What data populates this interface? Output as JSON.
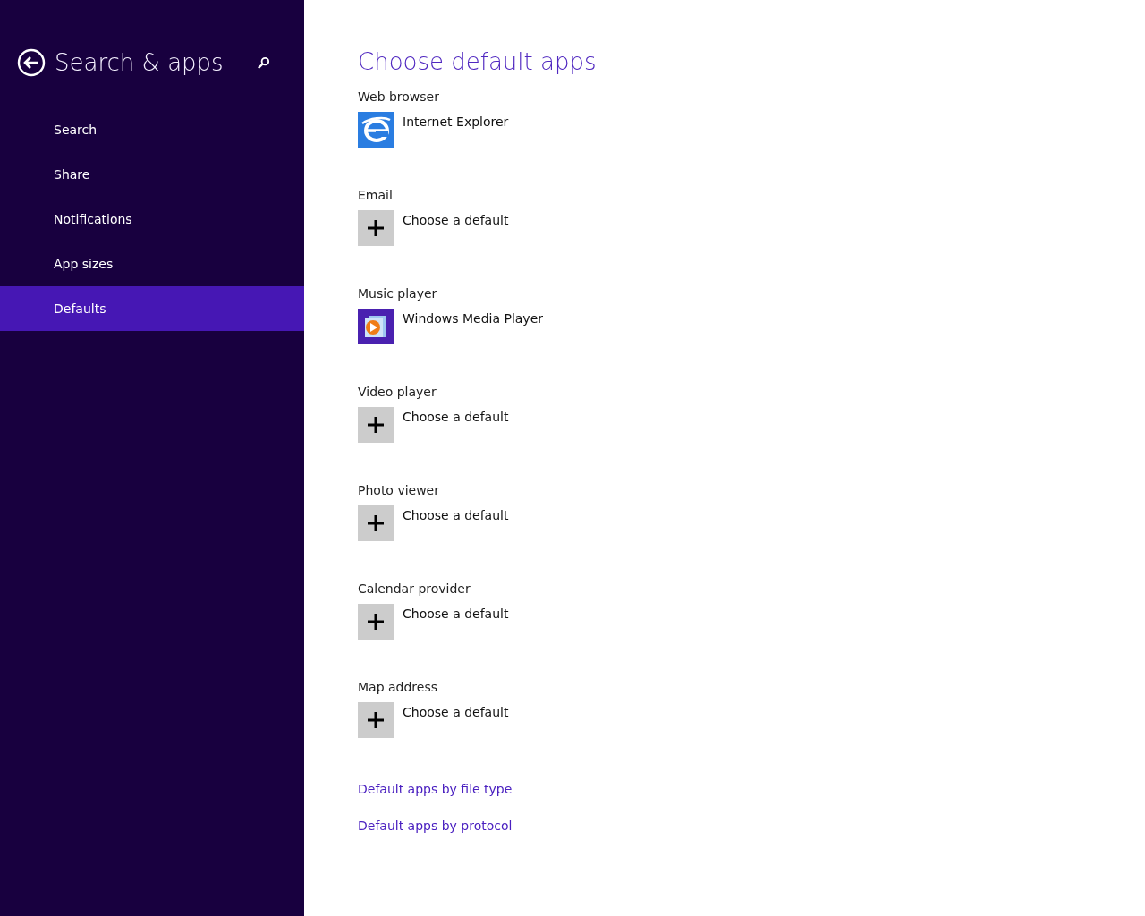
{
  "sidebar": {
    "title": "Search & apps",
    "items": [
      {
        "label": "Search",
        "selected": false
      },
      {
        "label": "Share",
        "selected": false
      },
      {
        "label": "Notifications",
        "selected": false
      },
      {
        "label": "App sizes",
        "selected": false
      },
      {
        "label": "Defaults",
        "selected": true
      }
    ]
  },
  "main": {
    "title": "Choose default apps",
    "categories": [
      {
        "label": "Web browser",
        "app": "Internet Explorer",
        "kind": "browser"
      },
      {
        "label": "Email",
        "app": "Choose a default",
        "kind": "empty"
      },
      {
        "label": "Music player",
        "app": "Windows Media Player",
        "kind": "media"
      },
      {
        "label": "Video player",
        "app": "Choose a default",
        "kind": "empty"
      },
      {
        "label": "Photo viewer",
        "app": "Choose a default",
        "kind": "empty"
      },
      {
        "label": "Calendar provider",
        "app": "Choose a default",
        "kind": "empty"
      },
      {
        "label": "Map address",
        "app": "Choose a default",
        "kind": "empty"
      }
    ],
    "links": [
      "Default apps by file type",
      "Default apps by protocol"
    ]
  }
}
